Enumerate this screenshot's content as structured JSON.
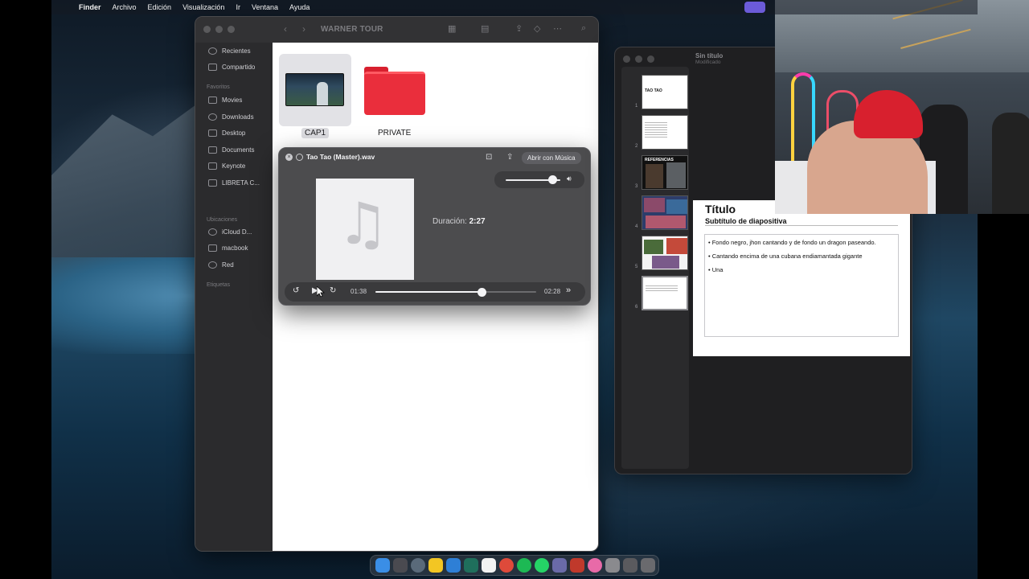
{
  "menubar": {
    "apple_icon": "",
    "items": [
      "Finder",
      "Archivo",
      "Edición",
      "Visualización",
      "Ir",
      "Ventana",
      "Ayuda"
    ]
  },
  "finder": {
    "title": "WARNER TOUR",
    "sidebar": {
      "top": [
        "Recientes",
        "Compartido"
      ],
      "favorites_header": "Favoritos",
      "favorites": [
        "Movies",
        "Downloads",
        "Desktop",
        "Documents",
        "Keynote",
        "LIBRETA C..."
      ],
      "locations_header": "Ubicaciones",
      "locations": [
        "iCloud D...",
        "macbook",
        "Red"
      ],
      "tags_header": "Etiquetas"
    },
    "files": [
      {
        "name": "CAP1",
        "kind": "video"
      },
      {
        "name": "PRIVATE",
        "kind": "folder"
      }
    ]
  },
  "quicklook": {
    "filename": "Tao Tao (Master).wav",
    "open_button": "Abrir con Música",
    "duration_label": "Duración:",
    "duration_value": "2:27",
    "elapsed": "01:38",
    "remaining": "02:28",
    "volume": 0.85,
    "progress": 0.66,
    "icons": [
      "close-icon",
      "minimize-icon",
      "fullscreen-icon",
      "share-icon",
      "speaker-icon",
      "skip-back-15-icon",
      "play-icon",
      "skip-forward-15-icon",
      "fast-forward-icon",
      "music-note-icon"
    ]
  },
  "keynote": {
    "doc_title": "Sin título",
    "doc_status": "Modificado",
    "slides": [
      {
        "num": "1",
        "title": "TAO TAO"
      },
      {
        "num": "2"
      },
      {
        "num": "3",
        "title": "REFERENCIAS"
      },
      {
        "num": "4"
      },
      {
        "num": "5"
      },
      {
        "num": "6"
      }
    ],
    "current_slide": {
      "title": "Título",
      "subtitle": "Subtítulo de diapositiva",
      "bullets": [
        "Fondo negro, jhon cantando y de fondo un dragon paseando.",
        "Cantando encima de una cubana endiamantada gigante",
        "Una"
      ]
    }
  },
  "colors": {
    "folder_red": "#ea2e3c",
    "accent_purple": "#6b5bd8"
  }
}
